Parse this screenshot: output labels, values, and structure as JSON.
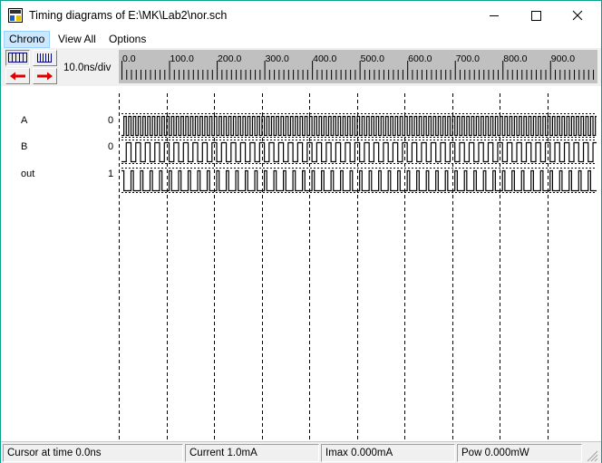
{
  "window": {
    "title": "Timing diagrams of E:\\MK\\Lab2\\nor.sch"
  },
  "menu": [
    "Chrono",
    "View All",
    "Options"
  ],
  "toolbar": {
    "scale": "10.0ns/div",
    "ruler_ticks": [
      "0.0",
      "100.0",
      "200.0",
      "300.0",
      "400.0",
      "500.0",
      "600.0",
      "700.0",
      "800.0",
      "900.0"
    ]
  },
  "signals": [
    {
      "name": "A",
      "value": "0",
      "half_period_ns": 5,
      "initial": 0
    },
    {
      "name": "B",
      "value": "0",
      "half_period_ns": 10,
      "initial": 0
    },
    {
      "name": "out",
      "value": "1",
      "logic": "NOR(A,B)"
    }
  ],
  "status": {
    "cursor": "Cursor at time  0.0ns",
    "current": "Current  1.0mA",
    "imax": "Imax 0.000mA",
    "power": "Pow 0.000mW"
  },
  "colors": {
    "title_border": "#0a9f8f",
    "ruler_bg": "#c0c0c0",
    "arrow_red": "#e00000"
  }
}
